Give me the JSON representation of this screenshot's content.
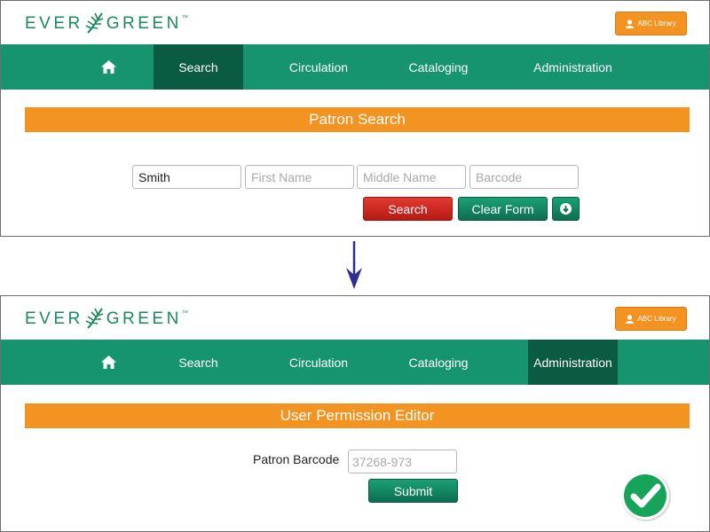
{
  "colors": {
    "brand_green": "#16946d",
    "nav_active": "#0b5b42",
    "accent_orange": "#f39322",
    "danger_red": "#c8231c",
    "arrow_blue": "#2e2e8f"
  },
  "logo": {
    "text_left": "EVER",
    "text_right": "GREEN",
    "tm": "™"
  },
  "library_button": {
    "label": "ABC Library",
    "icon": "user-icon"
  },
  "top_panel": {
    "nav": {
      "home_icon": "home-icon",
      "search": "Search",
      "circulation": "Circulation",
      "cataloging": "Cataloging",
      "administration": "Administration",
      "active": "Search"
    },
    "title": "Patron Search",
    "fields": {
      "last_name_value": "Smith",
      "first_name_placeholder": "First Name",
      "middle_name_placeholder": "Middle Name",
      "barcode_placeholder": "Barcode"
    },
    "buttons": {
      "search": "Search",
      "clear": "Clear Form",
      "advanced_icon": "circle-arrow-down-icon"
    }
  },
  "transition_icon": "arrow-down-icon",
  "bottom_panel": {
    "nav": {
      "home_icon": "home-icon",
      "search": "Search",
      "circulation": "Circulation",
      "cataloging": "Cataloging",
      "administration": "Administration",
      "active": "Administration"
    },
    "title": "User Permission Editor",
    "barcode_label": "Patron Barcode",
    "barcode_placeholder": "37268-973",
    "submit": "Submit",
    "status_icon": "checkmark-icon"
  }
}
